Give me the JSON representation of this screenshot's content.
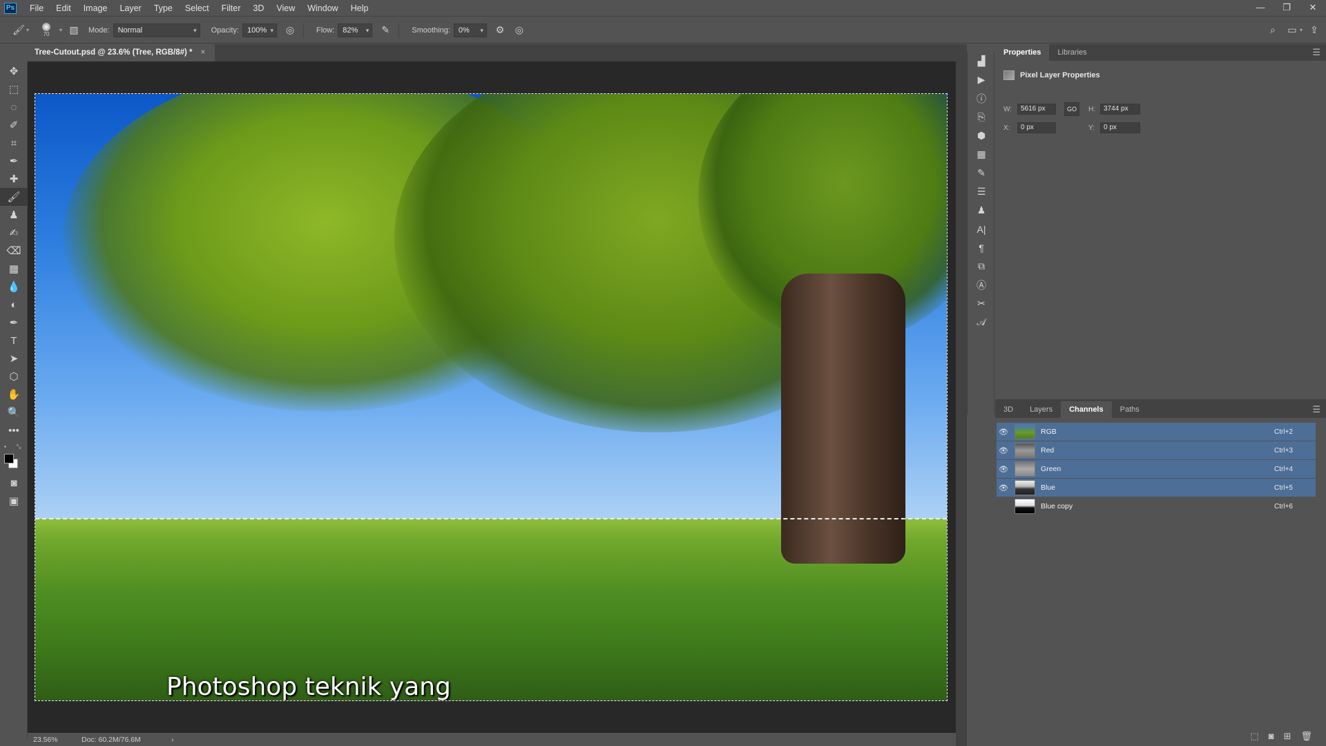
{
  "app": {
    "logo": "Ps"
  },
  "menu": [
    "File",
    "Edit",
    "Image",
    "Layer",
    "Type",
    "Select",
    "Filter",
    "3D",
    "View",
    "Window",
    "Help"
  ],
  "window_controls": {
    "minimize": "—",
    "restore": "❐",
    "close": "✕"
  },
  "options": {
    "brush_size": "70",
    "mode_label": "Mode:",
    "mode_value": "Normal",
    "opacity_label": "Opacity:",
    "opacity_value": "100%",
    "flow_label": "Flow:",
    "flow_value": "82%",
    "smoothing_label": "Smoothing:",
    "smoothing_value": "0%"
  },
  "document": {
    "tab_title": "Tree-Cutout.psd @ 23.6% (Tree, RGB/8#) *",
    "close": "×",
    "subtitle": "Photoshop teknik yang"
  },
  "status": {
    "zoom": "23.56%",
    "doc": "Doc: 60.2M/76.6M",
    "arrow": "›"
  },
  "properties_panel": {
    "tabs": [
      "Properties",
      "Libraries"
    ],
    "active_tab": "Properties",
    "section_title": "Pixel Layer Properties",
    "w_label": "W:",
    "w_value": "5616 px",
    "link_label": "GO",
    "h_label": "H:",
    "h_value": "3744 px",
    "x_label": "X:",
    "x_value": "0 px",
    "y_label": "Y:",
    "y_value": "0 px"
  },
  "channels_panel": {
    "tabs": [
      "3D",
      "Layers",
      "Channels",
      "Paths"
    ],
    "active_tab": "Channels",
    "channels": [
      {
        "name": "RGB",
        "shortcut": "Ctrl+2",
        "visible": true,
        "selected": true
      },
      {
        "name": "Red",
        "shortcut": "Ctrl+3",
        "visible": true,
        "selected": true
      },
      {
        "name": "Green",
        "shortcut": "Ctrl+4",
        "visible": true,
        "selected": true
      },
      {
        "name": "Blue",
        "shortcut": "Ctrl+5",
        "visible": true,
        "selected": true
      },
      {
        "name": "Blue copy",
        "shortcut": "Ctrl+6",
        "visible": false,
        "selected": false
      }
    ]
  },
  "colors": {
    "selection": "#4d6e97",
    "panel_bg": "#535353",
    "canvas_bg": "#282828"
  }
}
